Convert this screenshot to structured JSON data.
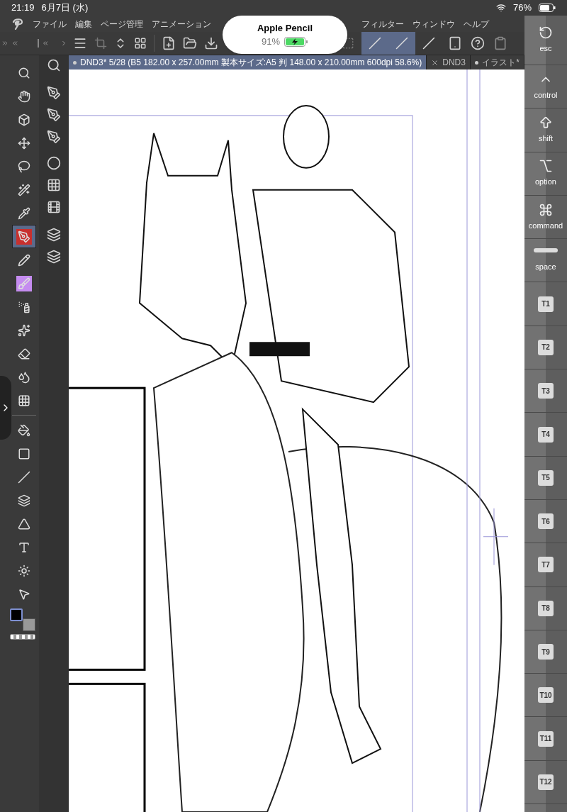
{
  "status_bar": {
    "time": "21:19",
    "date": "6月7日 (水)",
    "battery": "76%"
  },
  "menu": [
    "ファイル",
    "編集",
    "ページ管理",
    "アニメーション",
    "フィルター",
    "ウィンドウ",
    "ヘルプ"
  ],
  "pencil_popup": {
    "title": "Apple Pencil",
    "battery": "91%"
  },
  "snap_buttons": [
    {
      "selected": true
    },
    {
      "selected": true
    },
    {
      "selected": false
    }
  ],
  "tabs": [
    {
      "label": "DND3* 5/28 (B5 182.00 x 257.00mm 製本サイズ:A5 判 148.00 x 210.00mm 600dpi 58.6%)",
      "selected": true,
      "close_button": false
    },
    {
      "label": "DND3",
      "selected": false,
      "close_button": true
    },
    {
      "label": "イラスト*",
      "selected": false,
      "close_button": false
    }
  ],
  "tools": [
    {
      "selected": false
    },
    {
      "selected": false
    },
    {
      "selected": false
    },
    {
      "selected": false
    },
    {
      "selected": false
    },
    {
      "selected": false
    },
    {
      "selected": false
    },
    {
      "selected": true
    },
    {
      "selected": false
    },
    {
      "selected": false
    },
    {
      "selected": false
    },
    {
      "selected": false
    },
    {
      "selected": false
    },
    {
      "selected": false
    },
    {
      "selected": false
    },
    {
      "selected": false
    },
    {
      "selected": false
    },
    {
      "selected": false
    },
    {
      "selected": false
    },
    {
      "selected": false
    },
    {
      "selected": false
    },
    {
      "selected": false
    },
    {
      "selected": false
    }
  ],
  "keys": [
    {
      "kind": "icon",
      "label": "esc"
    },
    {
      "kind": "icon",
      "label": "control"
    },
    {
      "kind": "icon",
      "label": "shift"
    },
    {
      "kind": "icon",
      "label": "option"
    },
    {
      "kind": "icon",
      "label": "command"
    },
    {
      "kind": "icon",
      "label": "space"
    },
    {
      "kind": "box",
      "label": "T1"
    },
    {
      "kind": "box",
      "label": "T2"
    },
    {
      "kind": "box",
      "label": "T3"
    },
    {
      "kind": "box",
      "label": "T4"
    },
    {
      "kind": "box",
      "label": "T5"
    },
    {
      "kind": "box",
      "label": "T6"
    },
    {
      "kind": "box",
      "label": "T7"
    },
    {
      "kind": "box",
      "label": "T8"
    },
    {
      "kind": "box",
      "label": "T9"
    },
    {
      "kind": "box",
      "label": "T10"
    },
    {
      "kind": "box",
      "label": "T11"
    },
    {
      "kind": "box",
      "label": "T12"
    }
  ]
}
